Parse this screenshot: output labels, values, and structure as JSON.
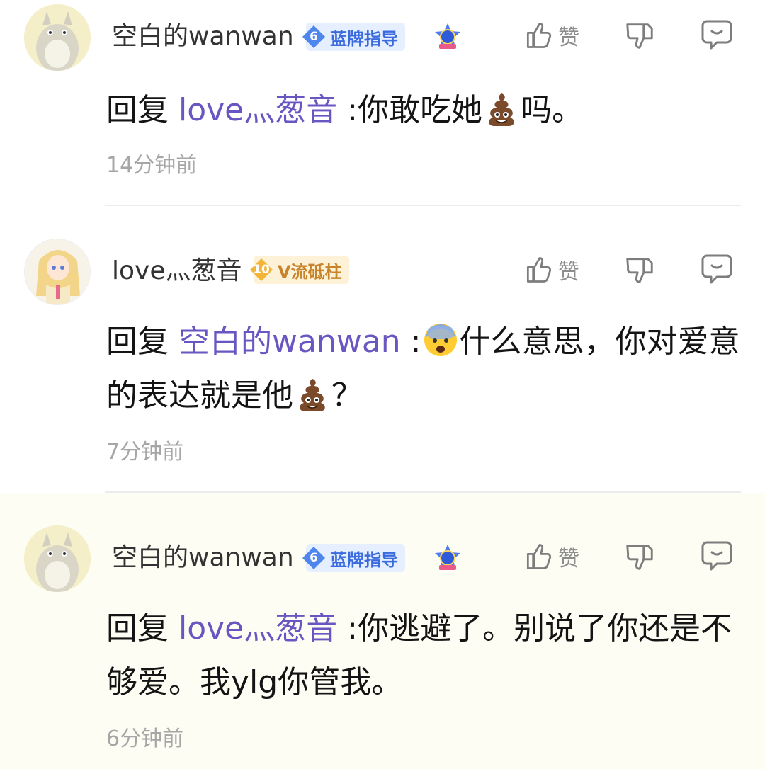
{
  "comments": [
    {
      "username": "空白的wanwan",
      "badge_level": "6",
      "badge_name": "蓝牌指导",
      "medal_number": "1",
      "like_label": "赞",
      "reply_prefix": "回复",
      "mention": "love灬葱音",
      "text_a": ":你敢吃她",
      "emoji_a": "poop-emoji",
      "text_b": "吗。",
      "time": "14分钟前"
    },
    {
      "username": "love灬葱音",
      "badge_level": "10",
      "badge_name": "V流砥柱",
      "like_label": "赞",
      "reply_prefix": "回复",
      "mention": "空白的wanwan",
      "text_a": ":",
      "emoji_a": "fearful-face-emoji",
      "text_b": "什么意思，你对爱意的表达就是他",
      "emoji_b": "poop-emoji",
      "text_c": "？",
      "time": "7分钟前"
    },
    {
      "username": "空白的wanwan",
      "badge_level": "6",
      "badge_name": "蓝牌指导",
      "medal_number": "1",
      "like_label": "赞",
      "reply_prefix": "回复",
      "mention": "love灬葱音",
      "text_a": ":你逃避了。别说了你还是不够爱。我ylg你管我。",
      "time": "6分钟前"
    }
  ],
  "colors": {
    "mention": "#6a56c2",
    "blue_badge": "#3a6bde",
    "gold_badge": "#c7842a",
    "highlight_bg": "#fdfdf3"
  }
}
